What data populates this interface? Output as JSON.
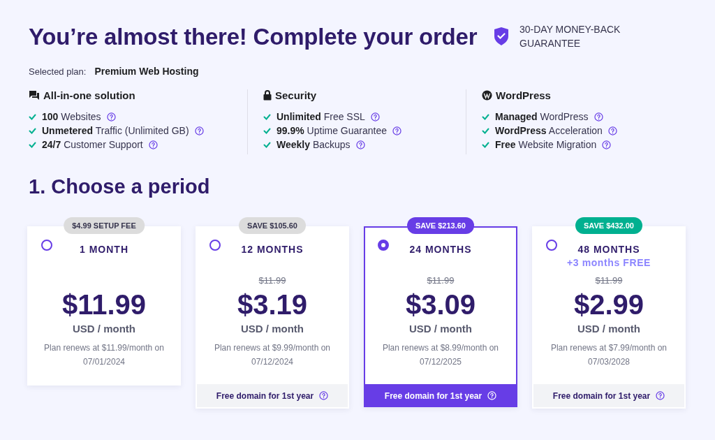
{
  "title": "You’re almost there! Complete your order",
  "guarantee": {
    "text": "30-DAY MONEY-BACK GUARANTEE"
  },
  "selected_plan": {
    "label": "Selected plan:",
    "value": "Premium Web Hosting"
  },
  "feature_groups": [
    {
      "kind": "chat",
      "title": "All-in-one solution",
      "items": [
        "**100** Websites",
        "**Unmetered** Traffic (Unlimited GB)",
        "**24/7** Customer Support"
      ]
    },
    {
      "kind": "lock",
      "title": "Security",
      "items": [
        "**Unlimited** Free SSL",
        "**99.9%** Uptime Guarantee",
        "**Weekly** Backups"
      ]
    },
    {
      "kind": "wordpress",
      "title": "WordPress",
      "items": [
        "**Managed** WordPress",
        "**WordPress** Acceleration",
        "**Free** Website Migration"
      ]
    }
  ],
  "section_title": "1. Choose a period",
  "periods": [
    {
      "badge": {
        "text": "$4.99 SETUP FEE",
        "color": "#dcdcdc"
      },
      "name": "1 MONTH",
      "selected": false,
      "price": "$11.99",
      "unit": "USD / month",
      "renewal": "Plan renews at $11.99/month on 07/01/2024"
    },
    {
      "badge": {
        "text": "SAVE $105.60",
        "color": "#dcdcdc"
      },
      "name": "12 MONTHS",
      "selected": false,
      "old_price": "$11.99",
      "price": "$3.19",
      "unit": "USD / month",
      "renewal": "Plan renews at $9.99/month on 07/12/2024",
      "footer": "Free domain for 1st year"
    },
    {
      "badge": {
        "text": "SAVE $213.60",
        "color": "#673de6"
      },
      "name": "24 MONTHS",
      "selected": true,
      "old_price": "$11.99",
      "price": "$3.09",
      "unit": "USD / month",
      "renewal": "Plan renews at $8.99/month on 07/12/2025",
      "footer": "Free domain for 1st year"
    },
    {
      "badge": {
        "text": "SAVE $432.00",
        "color": "#00b090"
      },
      "name": "48 MONTHS",
      "bonus": "+3 months FREE",
      "selected": false,
      "old_price": "$11.99",
      "price": "$2.99",
      "unit": "USD / month",
      "renewal": "Plan renews at $7.99/month on 07/03/2028",
      "footer": "Free domain for 1st year"
    }
  ]
}
